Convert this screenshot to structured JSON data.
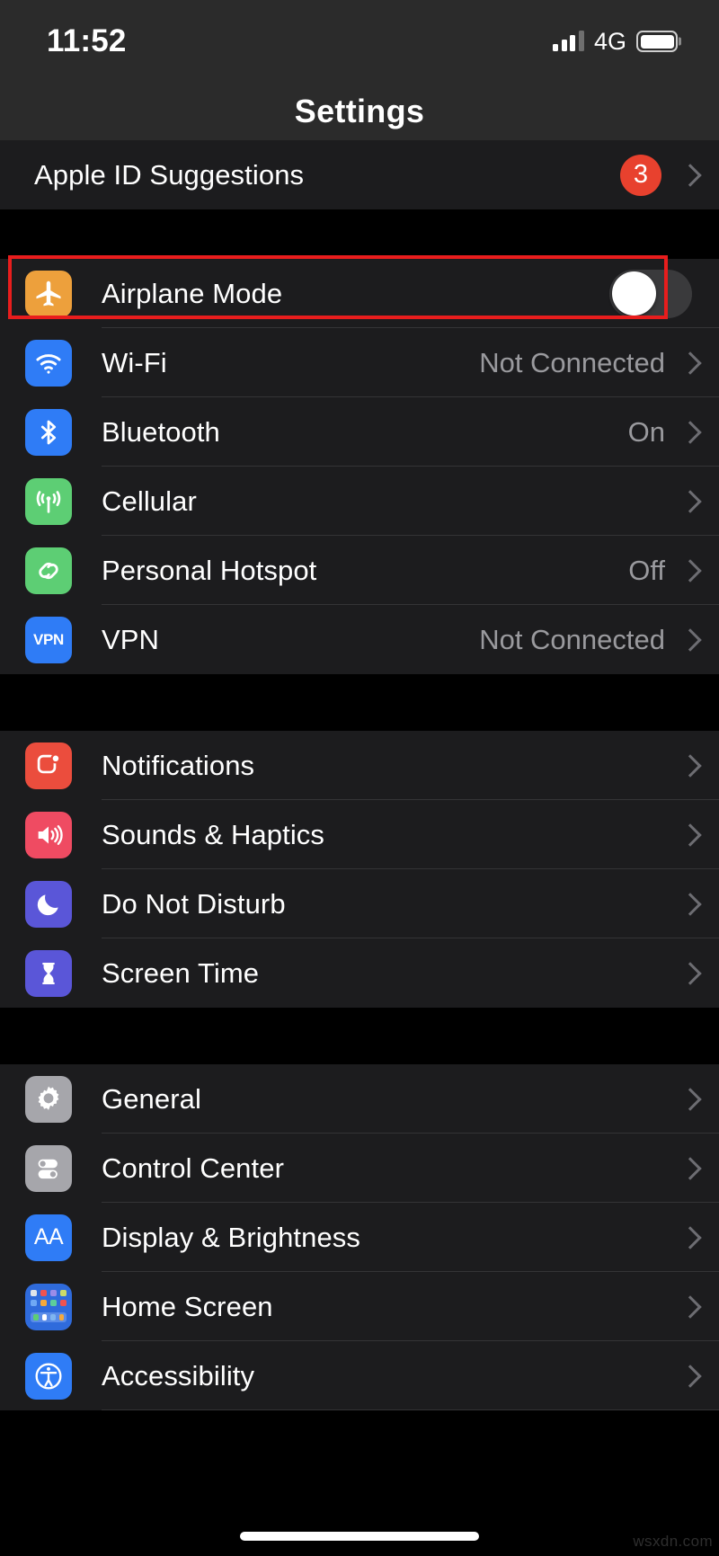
{
  "status_bar": {
    "time": "11:52",
    "network_label": "4G",
    "signal_icon": "cellular-signal-icon",
    "battery_icon": "battery-full-icon",
    "battery_level": 100,
    "signal_bars_filled": 3,
    "signal_bars_total": 4
  },
  "nav": {
    "title": "Settings"
  },
  "colors": {
    "highlight": "#e81d1d",
    "badge": "#e8412e",
    "group_bg": "#1c1c1e",
    "page_bg": "#000000",
    "value_text": "#9a9a9e"
  },
  "groups": [
    {
      "name": "apple-id-group",
      "rows": [
        {
          "label": "Apple ID Suggestions",
          "icon": null,
          "badge": "3",
          "value": null,
          "accessory": "chevron"
        }
      ]
    },
    {
      "name": "connectivity-group",
      "rows": [
        {
          "label": "Airplane Mode",
          "icon": "airplane-icon",
          "value": null,
          "accessory": "toggle",
          "toggle_on": false,
          "highlighted": true
        },
        {
          "label": "Wi-Fi",
          "icon": "wifi-icon",
          "value": "Not Connected",
          "accessory": "chevron"
        },
        {
          "label": "Bluetooth",
          "icon": "bluetooth-icon",
          "value": "On",
          "accessory": "chevron"
        },
        {
          "label": "Cellular",
          "icon": "cellular-antenna-icon",
          "value": "",
          "accessory": "chevron"
        },
        {
          "label": "Personal Hotspot",
          "icon": "hotspot-icon",
          "value": "Off",
          "accessory": "chevron"
        },
        {
          "label": "VPN",
          "icon": "vpn-icon",
          "value": "Not Connected",
          "accessory": "chevron"
        }
      ]
    },
    {
      "name": "notifications-group",
      "rows": [
        {
          "label": "Notifications",
          "icon": "notifications-icon",
          "value": "",
          "accessory": "chevron"
        },
        {
          "label": "Sounds & Haptics",
          "icon": "sounds-icon",
          "value": "",
          "accessory": "chevron"
        },
        {
          "label": "Do Not Disturb",
          "icon": "moon-icon",
          "value": "",
          "accessory": "chevron"
        },
        {
          "label": "Screen Time",
          "icon": "hourglass-icon",
          "value": "",
          "accessory": "chevron"
        }
      ]
    },
    {
      "name": "general-group",
      "rows": [
        {
          "label": "General",
          "icon": "gear-icon",
          "value": "",
          "accessory": "chevron"
        },
        {
          "label": "Control Center",
          "icon": "control-center-icon",
          "value": "",
          "accessory": "chevron"
        },
        {
          "label": "Display & Brightness",
          "icon": "display-brightness-icon",
          "icon_text": "AA",
          "value": "",
          "accessory": "chevron"
        },
        {
          "label": "Home Screen",
          "icon": "home-screen-icon",
          "value": "",
          "accessory": "chevron"
        },
        {
          "label": "Accessibility",
          "icon": "accessibility-icon",
          "value": "",
          "accessory": "chevron"
        }
      ]
    }
  ],
  "vpn_icon_text": "VPN",
  "watermark": "wsxdn.com"
}
